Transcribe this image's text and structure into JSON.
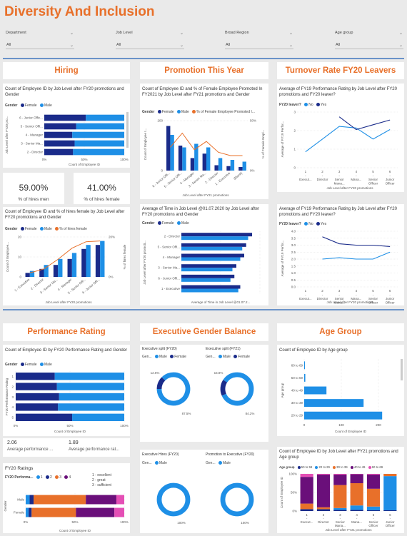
{
  "title": "Diversity And Inclusion",
  "colors": {
    "accent": "#e8702a",
    "female": "#1a2b8a",
    "male": "#1e8fe6",
    "pct_female": "#e8702a",
    "divider": "#6b93c9"
  },
  "slicers": [
    {
      "label": "Department",
      "value": "All"
    },
    {
      "label": "Job Level",
      "value": "All"
    },
    {
      "label": "Broad Region",
      "value": "All"
    },
    {
      "label": "Age group",
      "value": "All"
    }
  ],
  "sections": {
    "hiring": "Hiring",
    "promotion": "Promotion This Year",
    "turnover": "Turnover Rate FY20 Leavers",
    "performance": "Performance Rating",
    "exec_gender": "Executive Gender Balance",
    "age_group": "Age Group"
  },
  "hiring": {
    "chart1_title": "Count of Employee ID by Job Level after FY20 promotions and Gender",
    "legend_label": "Gender",
    "legend_female": "Female",
    "legend_male": "Male",
    "chart1_xlabel": "Count of Employee ID",
    "chart1_ylabel": "Job Level after FY20 pro...",
    "kpi_men_value": "59.00%",
    "kpi_men_label": "% of hires men",
    "kpi_female_value": "41.00%",
    "kpi_female_label": "% of hires female",
    "chart2_title": "Count of Employee ID and % of hires female by Job Level after FY20 promotions and Gender",
    "chart2_legend_pct": "% of hires female",
    "chart2_xlabel": "Job Level after FY20 promotions",
    "chart2_ylabel": "Count of Employee...",
    "chart2_y2label": "% of hires female"
  },
  "promotion": {
    "chart1_title": "Count of Employee ID and % of Female Employee Promoted In FY2021 by Job Level after FY21 promotions and Gender",
    "legend_pct": "% of Female Employee Promoted I...",
    "chart1_xlabel": "Job Level after FY21 promotions",
    "chart1_ylabel": "Count of Employee I...",
    "chart1_y2label": "% of Female Empl...",
    "chart2_title": "Average of Time in Job Level @01.07.2020 by Job Level after FY20 promotions and Gender",
    "chart2_xlabel": "Average of Time in Job Level @01.07.2...",
    "chart2_ylabel": "Job Level after FY20 promoti..."
  },
  "turnover": {
    "chart1_title": "Average of FY19 Performance Rating by Job Level after FY20 promotions and FY20 leaver?",
    "chart1_ylabel": "Average of FY19 Perfor...",
    "chart1_xlabel": "Job Level after FY20 promotions",
    "legend_label": "FY20 leaver?",
    "legend_no": "No",
    "legend_yes": "Yes",
    "chart2_title": "Average of FY19 Performance Rating by Job Level after FY20 promotions and FY20 leaver?",
    "chart2_ylabel": "Average of FY19 Perfor...",
    "chart2_xlabel": "Job Level after FY20 promotions"
  },
  "performance": {
    "chart_title": "Count of Employee ID by FY20 Performance Rating and Gender",
    "chart_xlabel": "Count of Employee ID",
    "chart_ylabel": "FY20 Performance Rating",
    "kpi1_value": "2.06",
    "kpi1_label": "Average performance ...",
    "kpi2_value": "1.89",
    "kpi2_label": "Average performance rat...",
    "ratings_title": "FY20 Ratings",
    "ratings_legend_label": "FY20 Performa...",
    "ratings_legend_items": [
      "1",
      "2",
      "3",
      "4"
    ],
    "rating_notes": [
      "1 - excellent",
      "2 - great",
      "3 - sufficient"
    ],
    "ratings_xlabel": "Count of Employee ID",
    "ratings_ylabel": "Gender",
    "rows": [
      "Male",
      "Female"
    ]
  },
  "exec_gender": {
    "d1_title": "Executive split (FY20)",
    "d2_title": "Executive split (FY21)",
    "d3_title": "Executive Hires (FY20)",
    "d4_title": "Promotion to Executive (FY20)",
    "legend_label": "Gen...",
    "male": "Male",
    "female": "Female"
  },
  "age_group": {
    "chart1_title": "Count of Employee ID by Age group",
    "chart1_xlabel": "Count of Employee ID",
    "chart1_ylabel": "Age group",
    "chart2_title": "Count of Employee ID by Job Level after FY21 promotions and Age group",
    "legend_label": "Age group",
    "legend_items": [
      "50 to 59",
      "20 to 29",
      "30 to 39",
      "40 to 49",
      "60 to 69"
    ],
    "chart2_xlabel": "Job Level after FY21 promotions",
    "chart2_ylabel": "Count of Employee ID"
  },
  "chart_data": [
    {
      "id": "hiring_joblevel_gender",
      "type": "bar",
      "orientation": "horizontal",
      "stacked": "100%",
      "categories": [
        "6 - Junior Offic...",
        "5 - Senior Offi...",
        "4 - Manager",
        "3 - Senior Ma...",
        "2 - Director"
      ],
      "series": [
        {
          "name": "Female",
          "values": [
            0.52,
            0.4,
            0.35,
            0.38,
            0.36
          ]
        },
        {
          "name": "Male",
          "values": [
            0.48,
            0.6,
            0.65,
            0.62,
            0.64
          ]
        }
      ],
      "xticks": [
        "0%",
        "50%",
        "100%"
      ]
    },
    {
      "id": "hiring_count_pct_female",
      "type": "bar",
      "categories": [
        "1 - Executive",
        "2 - Director",
        "3 - Senior Ma...",
        "4 - Manager",
        "5 - Senior Offi...",
        "6 - Junior Offi..."
      ],
      "series": [
        {
          "name": "Female",
          "values": [
            2,
            4,
            6,
            9,
            14,
            16
          ]
        },
        {
          "name": "Male",
          "values": [
            3,
            6,
            9,
            12,
            16,
            18
          ]
        },
        {
          "name": "% of hires female",
          "type": "line",
          "values": [
            0.05,
            0.1,
            0.22,
            0.36,
            0.44,
            0.45
          ]
        }
      ],
      "yticks": [
        "0",
        "10",
        "20"
      ],
      "y2ticks": [
        "0%",
        "20%"
      ]
    },
    {
      "id": "promotion_count_pct",
      "type": "bar",
      "categories": [
        "6 - Junior Offi...",
        "5 - Senior Offi...",
        "4 - Manager",
        "3 - Senior Ma...",
        "2 - Director",
        "1 - Executive",
        "(Blank)"
      ],
      "series": [
        {
          "name": "Female",
          "values": [
            250,
            140,
            70,
            95,
            30,
            25,
            20
          ]
        },
        {
          "name": "Male",
          "values": [
            200,
            130,
            150,
            130,
            70,
            60,
            50
          ]
        },
        {
          "name": "% of Female Employee Promoted In FY2021",
          "type": "line",
          "values": [
            0.28,
            0.45,
            0.25,
            0.35,
            0.22,
            0.18,
            0.18
          ]
        }
      ],
      "yticks": [
        "0",
        "200"
      ],
      "y2ticks": [
        "0%",
        "50%"
      ]
    },
    {
      "id": "promotion_time_in_level",
      "type": "bar",
      "orientation": "horizontal",
      "categories": [
        "2 - Director",
        "5 - Senior Offi...",
        "4 - Manager",
        "3 - Senior Ma...",
        "6 - Junior Offi...",
        "1 - Executive"
      ],
      "series": [
        {
          "name": "Female",
          "values": [
            3.6,
            3.3,
            3.2,
            2.8,
            2.7,
            3.0
          ]
        },
        {
          "name": "Male",
          "values": [
            3.4,
            3.1,
            3.0,
            2.6,
            2.5,
            2.9
          ]
        }
      ],
      "xticks": [
        "0",
        "2",
        "4"
      ]
    },
    {
      "id": "turnover_perf_1",
      "type": "line",
      "categories": [
        "1 - Execut...",
        "2 - Director",
        "3 - Senior Mana...",
        "4 - Mana...",
        "5 - Senior Officer",
        "6 - Junior Officer"
      ],
      "series": [
        {
          "name": "No",
          "values": [
            1.0,
            1.8,
            2.6,
            2.5,
            1.8,
            2.4
          ]
        },
        {
          "name": "Yes",
          "values": [
            null,
            null,
            3.2,
            2.4,
            2.7,
            3.0
          ]
        }
      ],
      "yticks": [
        "0",
        "1",
        "2",
        "3"
      ]
    },
    {
      "id": "turnover_perf_2",
      "type": "line",
      "categories": [
        "1 - Execut...",
        "2 - Director",
        "3 - Senior Mana...",
        "4 - Mana...",
        "5 - Senior Officer",
        "6 - Junior Officer"
      ],
      "series": [
        {
          "name": "No",
          "values": [
            null,
            2.0,
            2.1,
            2.0,
            2.0,
            2.5
          ]
        },
        {
          "name": "Yes",
          "values": [
            null,
            3.6,
            3.1,
            3.0,
            3.0,
            2.9
          ]
        }
      ],
      "yticks": [
        "0.0",
        "0.5",
        "1.0",
        "1.5",
        "2.0",
        "2.5",
        "3.0",
        "3.5",
        "4.0"
      ]
    },
    {
      "id": "perf_rating_gender",
      "type": "bar",
      "orientation": "horizontal",
      "stacked": "100%",
      "categories": [
        "1",
        "2",
        "3",
        "4",
        "5"
      ],
      "series": [
        {
          "name": "Female",
          "values": [
            0.36,
            0.38,
            0.4,
            0.39,
            0.52
          ]
        },
        {
          "name": "Male",
          "values": [
            0.64,
            0.62,
            0.6,
            0.61,
            0.48
          ]
        }
      ],
      "xticks": [
        "0%",
        "50%",
        "100%"
      ]
    },
    {
      "id": "fy20_ratings",
      "type": "bar",
      "orientation": "horizontal",
      "stacked": "100%",
      "categories": [
        "Male",
        "Female"
      ],
      "series": [
        {
          "name": "1",
          "values": [
            0.04,
            0.03
          ]
        },
        {
          "name": "2",
          "values": [
            0.04,
            0.03
          ]
        },
        {
          "name": "3",
          "values": [
            0.53,
            0.45
          ]
        },
        {
          "name": "4",
          "values": [
            0.31,
            0.39
          ]
        },
        {
          "name": "5",
          "values": [
            0.08,
            0.1
          ]
        }
      ],
      "xticks": [
        "0%",
        "50%",
        "100%"
      ]
    },
    {
      "id": "exec_split_fy20",
      "type": "pie",
      "categories": [
        "Male",
        "Female"
      ],
      "values": [
        87.5,
        12.5
      ],
      "labels": [
        "87.5%",
        "12.5%"
      ]
    },
    {
      "id": "exec_split_fy21",
      "type": "pie",
      "categories": [
        "Male",
        "Female"
      ],
      "values": [
        84.2,
        15.8
      ],
      "labels": [
        "84.2%",
        "15.8%"
      ]
    },
    {
      "id": "exec_hires_fy20",
      "type": "pie",
      "categories": [
        "Male"
      ],
      "values": [
        100
      ],
      "labels": [
        "100%"
      ]
    },
    {
      "id": "promo_exec_fy20",
      "type": "pie",
      "categories": [
        "Male"
      ],
      "values": [
        100
      ],
      "labels": [
        "100%"
      ]
    },
    {
      "id": "age_group_count",
      "type": "bar",
      "orientation": "horizontal",
      "categories": [
        "60 to 69",
        "50 to 59",
        "40 to 49",
        "30 to 39",
        "20 to 29"
      ],
      "values": [
        2,
        3,
        60,
        160,
        210
      ],
      "xticks": [
        "0",
        "100",
        "200"
      ]
    },
    {
      "id": "joblevel_agegroup",
      "type": "bar",
      "stacked": "100%",
      "categories": [
        "1 - Execut...",
        "2 - Director",
        "3 - Senior Mana...",
        "4 - Mana...",
        "5 - Senior Officer",
        "6 - Junior Officer"
      ],
      "series": [
        {
          "name": "50 to 59",
          "values": [
            0.05,
            0.05,
            0.03,
            0.03,
            0.02,
            0.02
          ]
        },
        {
          "name": "20 to 29",
          "values": [
            0.0,
            0.0,
            0.05,
            0.12,
            0.1,
            0.92
          ]
        },
        {
          "name": "30 to 39",
          "values": [
            0.15,
            0.05,
            0.62,
            0.6,
            0.48,
            0.06
          ]
        },
        {
          "name": "40 to 49",
          "values": [
            0.72,
            0.88,
            0.28,
            0.24,
            0.38,
            0.0
          ]
        },
        {
          "name": "60 to 69",
          "values": [
            0.08,
            0.02,
            0.02,
            0.01,
            0.02,
            0.0
          ]
        }
      ],
      "yticks": [
        "0%",
        "50%",
        "100%"
      ]
    }
  ]
}
